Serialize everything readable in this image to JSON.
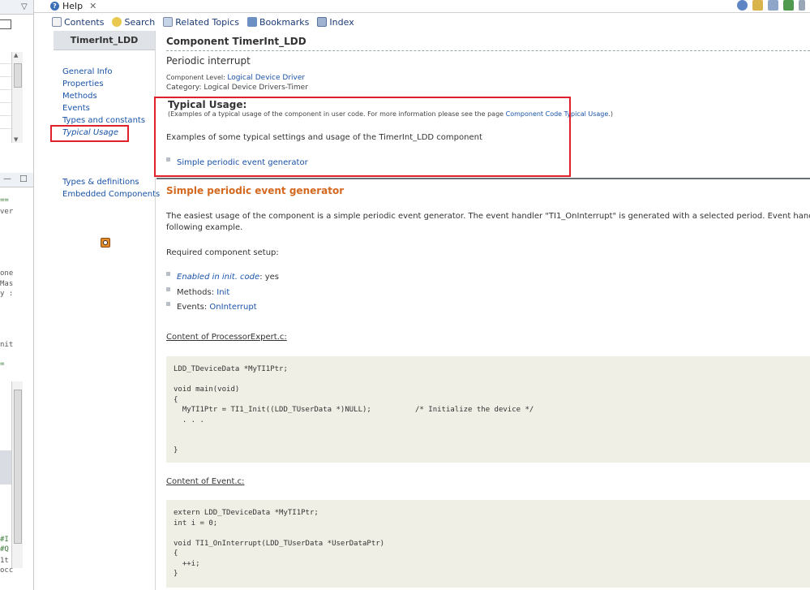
{
  "help_view": {
    "tab_label": "Help",
    "toolbar": {
      "contents": "Contents",
      "search": "Search",
      "related_topics": "Related Topics",
      "bookmarks": "Bookmarks",
      "index": "Index"
    }
  },
  "toc": {
    "header": "TimerInt_LDD",
    "items": [
      "General Info",
      "Properties",
      "Methods",
      "Events",
      "Types and constants",
      "Typical Usage",
      "Types & definitions",
      "Embedded Components"
    ]
  },
  "page": {
    "title": "Component TimerInt_LDD",
    "subtitle": "Periodic interrupt",
    "component_level_label": "Component Level: ",
    "component_level_value": "Logical Device Driver",
    "category": "Category: Logical Device Drivers-Timer",
    "typical_usage": {
      "title": "Typical Usage:",
      "note_prefix": "(Examples of a typical usage of the component in user code. For more information please see the page ",
      "note_link": "Component Code Typical Usage",
      "note_suffix": ".)",
      "intro": "Examples of some typical settings and usage of the TimerInt_LDD component",
      "examples": [
        "Simple periodic event generator"
      ]
    },
    "section": {
      "title": "Simple periodic event generator",
      "desc_line1": "The easiest usage of the component is a simple periodic event generator. The event handler \"TI1_OnInterrupt\" is generated with a selected period. Event handler executes as",
      "desc_line2": "following example.",
      "setup_label": "Required component setup:",
      "setup": {
        "enabled_label": "Enabled in init. code",
        "enabled_value": ": yes",
        "methods_label": "Methods: ",
        "methods_value": "Init",
        "events_label": "Events: ",
        "events_value": "OnInterrupt"
      },
      "file1_label": "Content of ProcessorExpert.c:",
      "file1_code": "LDD_TDeviceData *MyTI1Ptr;\n\nvoid main(void)\n{\n  MyTI1Ptr = TI1_Init((LDD_TUserData *)NULL);          /* Initialize the device */\n  . . .\n\n\n}",
      "file2_label": "Content of Event.c:",
      "file2_code": "extern LDD_TDeviceData *MyTI1Ptr;\nint i = 0;\n\nvoid TI1_OnInterrupt(LDD_TUserData *UserDataPtr)\n{\n  ++i;\n}"
    }
  },
  "left_pane_fragments": [
    "one",
    "Mas",
    "y :",
    "=",
    "==",
    "ver",
    "nit",
    "#I",
    "#Q",
    "occ",
    "1t",
    "r"
  ],
  "colors": {
    "link": "#1a53a8",
    "section_heading": "#d4681f",
    "highlight_box": "#e0202a",
    "code_bg": "#efefe6"
  }
}
